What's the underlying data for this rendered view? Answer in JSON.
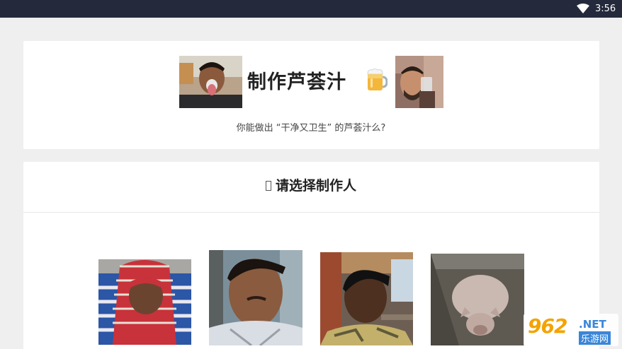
{
  "status_bar": {
    "time": "3:56",
    "wifi_icon": "wifi-icon"
  },
  "header": {
    "title": "制作芦荟汁",
    "subtitle": "你能做出 “干净又卫生” 的芦荟汁么?",
    "beer_icon": "beer-mug-icon",
    "left_photo": "boy-tongue-out-photo",
    "right_photo": "man-holding-glass-photo"
  },
  "select_section": {
    "title": "请选择制作人",
    "title_glyph": "missing-glyph-icon",
    "makers": [
      {
        "name": "maker-scarf-man-photo"
      },
      {
        "name": "maker-young-man-photo"
      },
      {
        "name": "maker-teen-man-photo"
      },
      {
        "name": "maker-pig-photo"
      }
    ]
  },
  "watermark": {
    "number": "962",
    "domain": ".NET",
    "chinese": "乐游网"
  },
  "colors": {
    "status_bar": "#242a3b",
    "background": "#efefef",
    "card": "#ffffff",
    "watermark_orange": "#f4a300",
    "watermark_blue": "#3a86d8"
  }
}
